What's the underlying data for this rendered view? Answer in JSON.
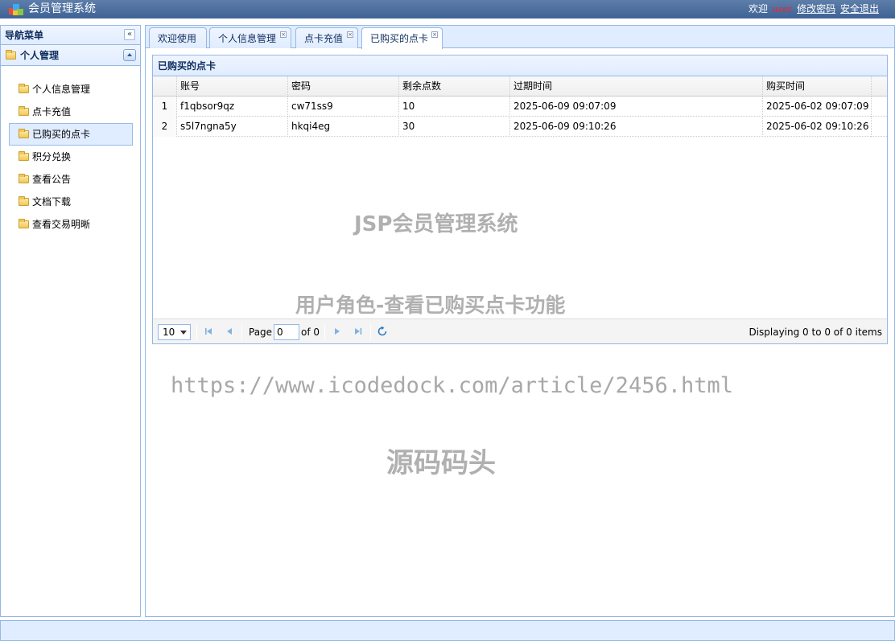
{
  "header": {
    "title": "会员管理系统",
    "welcome": "欢迎",
    "username": "user",
    "change_password": "修改密码",
    "logout": "安全退出"
  },
  "nav": {
    "title": "导航菜单",
    "collapse_glyph": "«",
    "group_title": "个人管理",
    "items": [
      {
        "label": "个人信息管理"
      },
      {
        "label": "点卡充值"
      },
      {
        "label": "已购买的点卡"
      },
      {
        "label": "积分兑换"
      },
      {
        "label": "查看公告"
      },
      {
        "label": "文档下载"
      },
      {
        "label": "查看交易明晰"
      }
    ],
    "active_index": 2
  },
  "tabs": [
    {
      "label": "欢迎使用",
      "closable": false
    },
    {
      "label": "个人信息管理",
      "closable": true
    },
    {
      "label": "点卡充值",
      "closable": true
    },
    {
      "label": "已购买的点卡",
      "closable": true
    }
  ],
  "panel": {
    "title": "已购买的点卡",
    "columns": [
      "账号",
      "密码",
      "剩余点数",
      "过期时间",
      "购买时间"
    ],
    "rows": [
      {
        "n": "1",
        "account": "f1qbsor9qz",
        "password": "cw71ss9",
        "points": "10",
        "expire": "2025-06-09 09:07:09",
        "bought": "2025-06-02 09:07:09"
      },
      {
        "n": "2",
        "account": "s5l7ngna5y",
        "password": "hkqi4eg",
        "points": "30",
        "expire": "2025-06-09 09:10:26",
        "bought": "2025-06-02 09:10:26"
      }
    ]
  },
  "pager": {
    "page_size": "10",
    "page_label": "Page",
    "page_value": "0",
    "of_label": "of 0",
    "info": "Displaying 0 to 0 of 0 items"
  },
  "watermarks": {
    "line1": "JSP会员管理系统",
    "line2": "用户角色-查看已购买点卡功能",
    "line3": "https://www.icodedock.com/article/2456.html",
    "line4": "源码码头"
  },
  "colors": {
    "header_bg": "#3e6296",
    "accent_border": "#95b8e7",
    "panel_bg": "#e0ecff",
    "username": "#ee2233"
  }
}
